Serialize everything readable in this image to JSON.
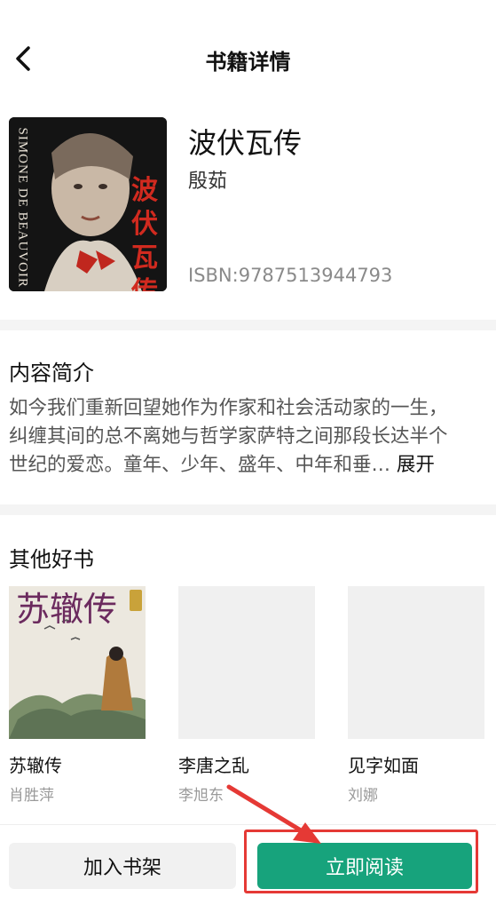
{
  "header": {
    "title": "书籍详情",
    "back_icon": "back-chevron-icon"
  },
  "book": {
    "title": "波伏瓦传",
    "author": "殷茹",
    "isbn": "ISBN:9787513944793",
    "cover_vertical_text": "SIMONE DE BEAUVOIR",
    "cover_title_chars": "波伏瓦传"
  },
  "intro": {
    "title": "内容简介",
    "lines": [
      "如今我们重新回望她作为作家和社会活动家的一生，",
      "纠缠其间的总不离她与哲学家萨特之间那段长达半个",
      "世纪的爱恋。童年、少年、盛年、中年和垂…"
    ],
    "expand_label": "展开"
  },
  "others": {
    "title": "其他好书",
    "books": [
      {
        "title": "苏辙传",
        "author": "肖胜萍",
        "cover_text": "苏辙传"
      },
      {
        "title": "李唐之乱",
        "author": "李旭东"
      },
      {
        "title": "见字如面",
        "author": "刘娜"
      }
    ]
  },
  "actions": {
    "add_shelf": "加入书架",
    "read_now": "立即阅读"
  },
  "colors": {
    "accent": "#17a37c",
    "highlight": "#e53935"
  }
}
